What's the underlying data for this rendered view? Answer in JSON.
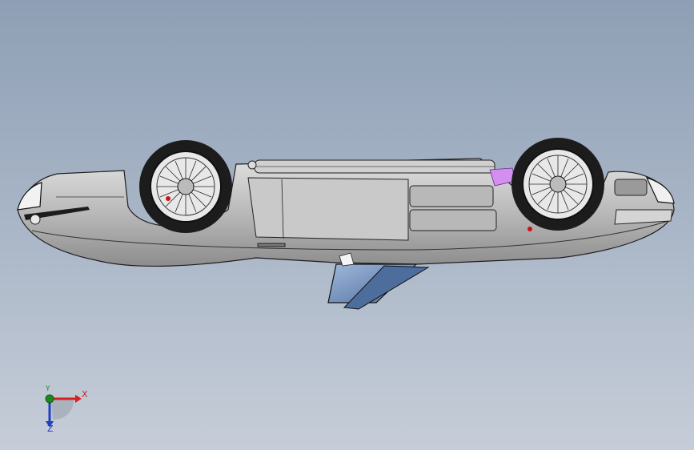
{
  "viewport": {
    "background_top": "#8e9fb5",
    "background_bottom": "#c6cdd8"
  },
  "model": {
    "body_color": "#c4c4c4",
    "glass_color": "#6d8fbf",
    "accent_color": "#d38ef0",
    "tire_color": "#1c1c1c"
  },
  "triad": {
    "x_label": "X",
    "y_label": "Y",
    "z_label": "Z",
    "x_color": "#d42020",
    "y_color": "#1a8a1a",
    "z_color": "#2040c0"
  }
}
